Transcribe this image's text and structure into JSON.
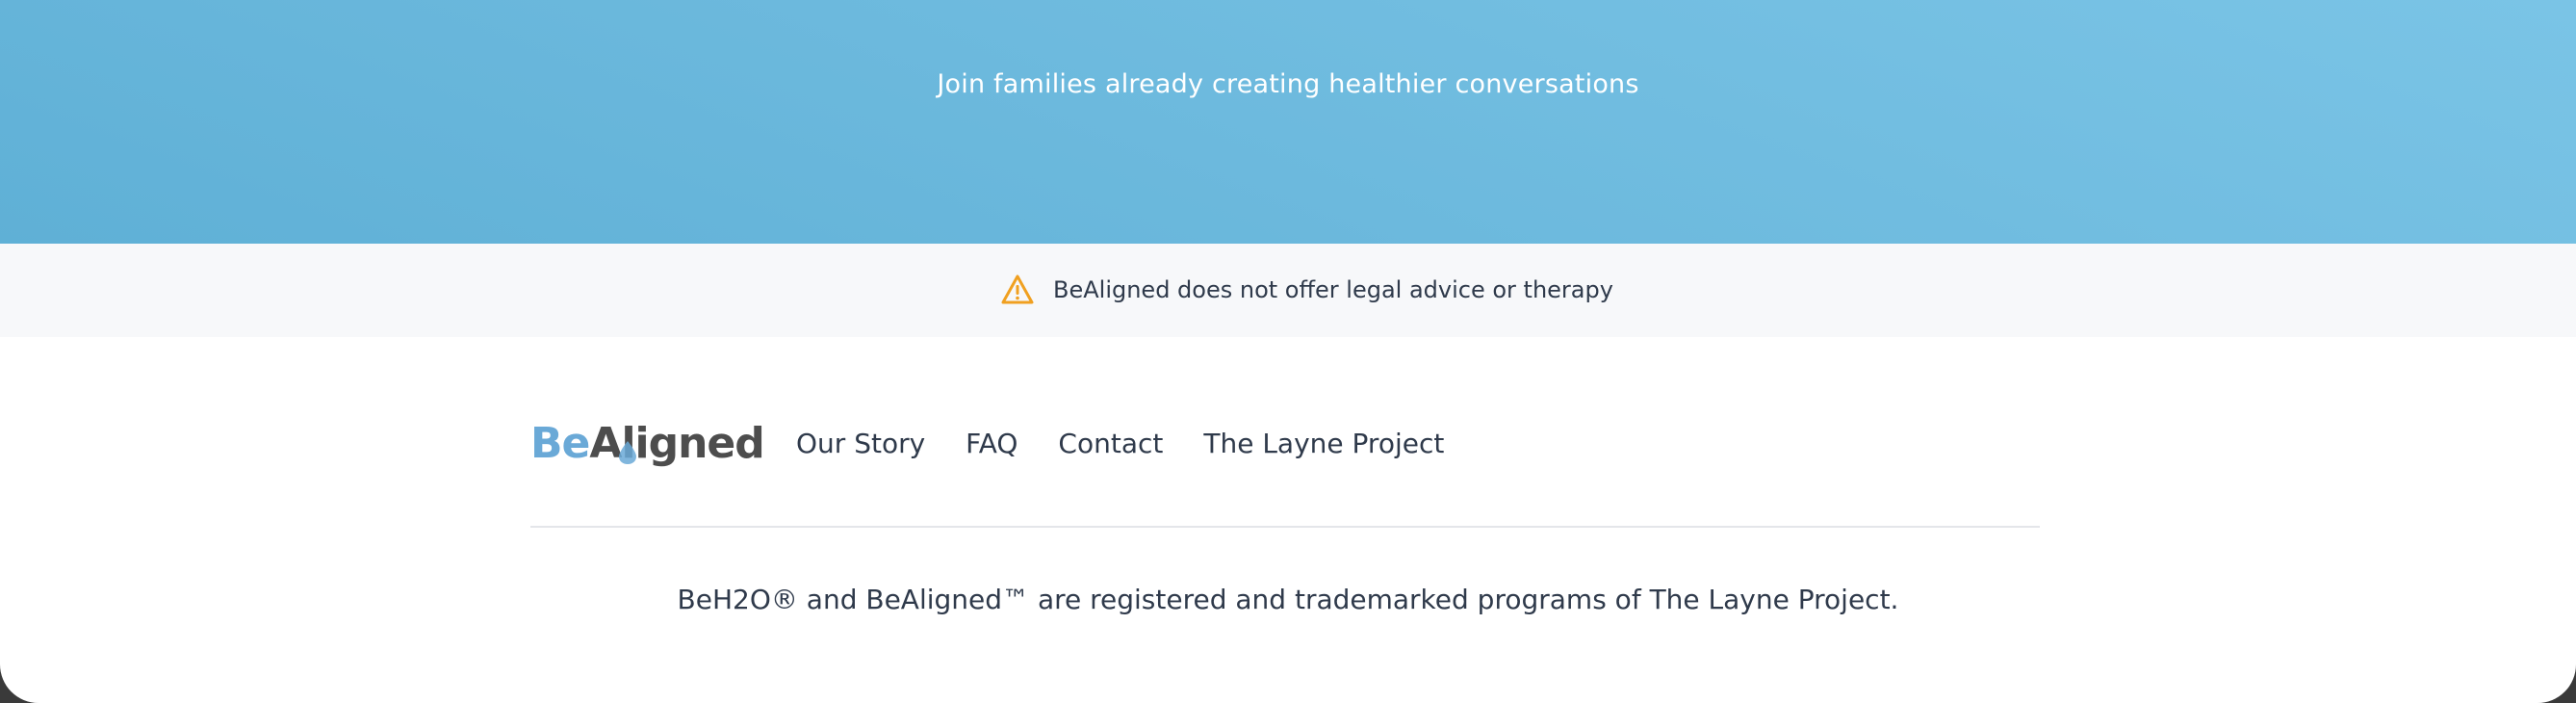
{
  "hero": {
    "tagline": "Join families already creating healthier conversations",
    "color_start": "#5fb0d6",
    "color_end": "#7ac4e6"
  },
  "disclaimer": {
    "icon": "warning-triangle-icon",
    "icon_color": "#f0a020",
    "text": "BeAligned does not offer legal advice or therapy"
  },
  "footer": {
    "logo": {
      "part_be": "Be",
      "part_aligned": "Aligned",
      "brand_blue": "#6aa9d7",
      "brand_gray": "#4d4d4d"
    },
    "nav": [
      {
        "label": "Our Story"
      },
      {
        "label": "FAQ"
      },
      {
        "label": "Contact"
      },
      {
        "label": "The Layne Project"
      }
    ],
    "legal": "BeH2O® and BeAligned™ are registered and trademarked programs of The Layne Project."
  }
}
